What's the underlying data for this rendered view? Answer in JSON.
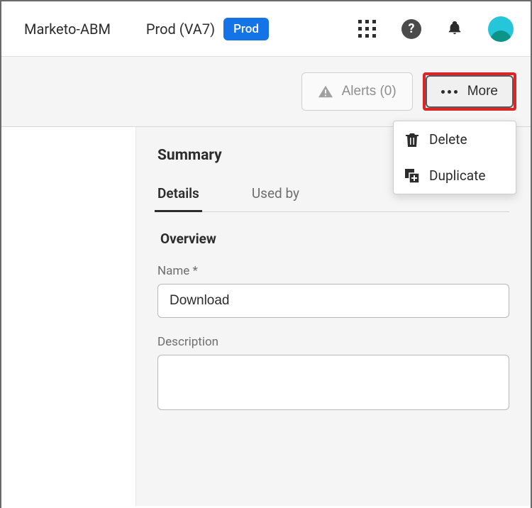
{
  "header": {
    "org": "Marketo-ABM",
    "env_name": "Prod (VA7)",
    "env_badge": "Prod"
  },
  "actions": {
    "alerts_label": "Alerts (0)",
    "more_label": "More"
  },
  "dropdown": {
    "delete": "Delete",
    "duplicate": "Duplicate"
  },
  "main": {
    "summary_title": "Summary",
    "tabs": {
      "details": "Details",
      "used_by": "Used by"
    },
    "overview": {
      "section_title": "Overview",
      "name_label": "Name *",
      "name_value": "Download",
      "description_label": "Description",
      "description_value": ""
    }
  }
}
